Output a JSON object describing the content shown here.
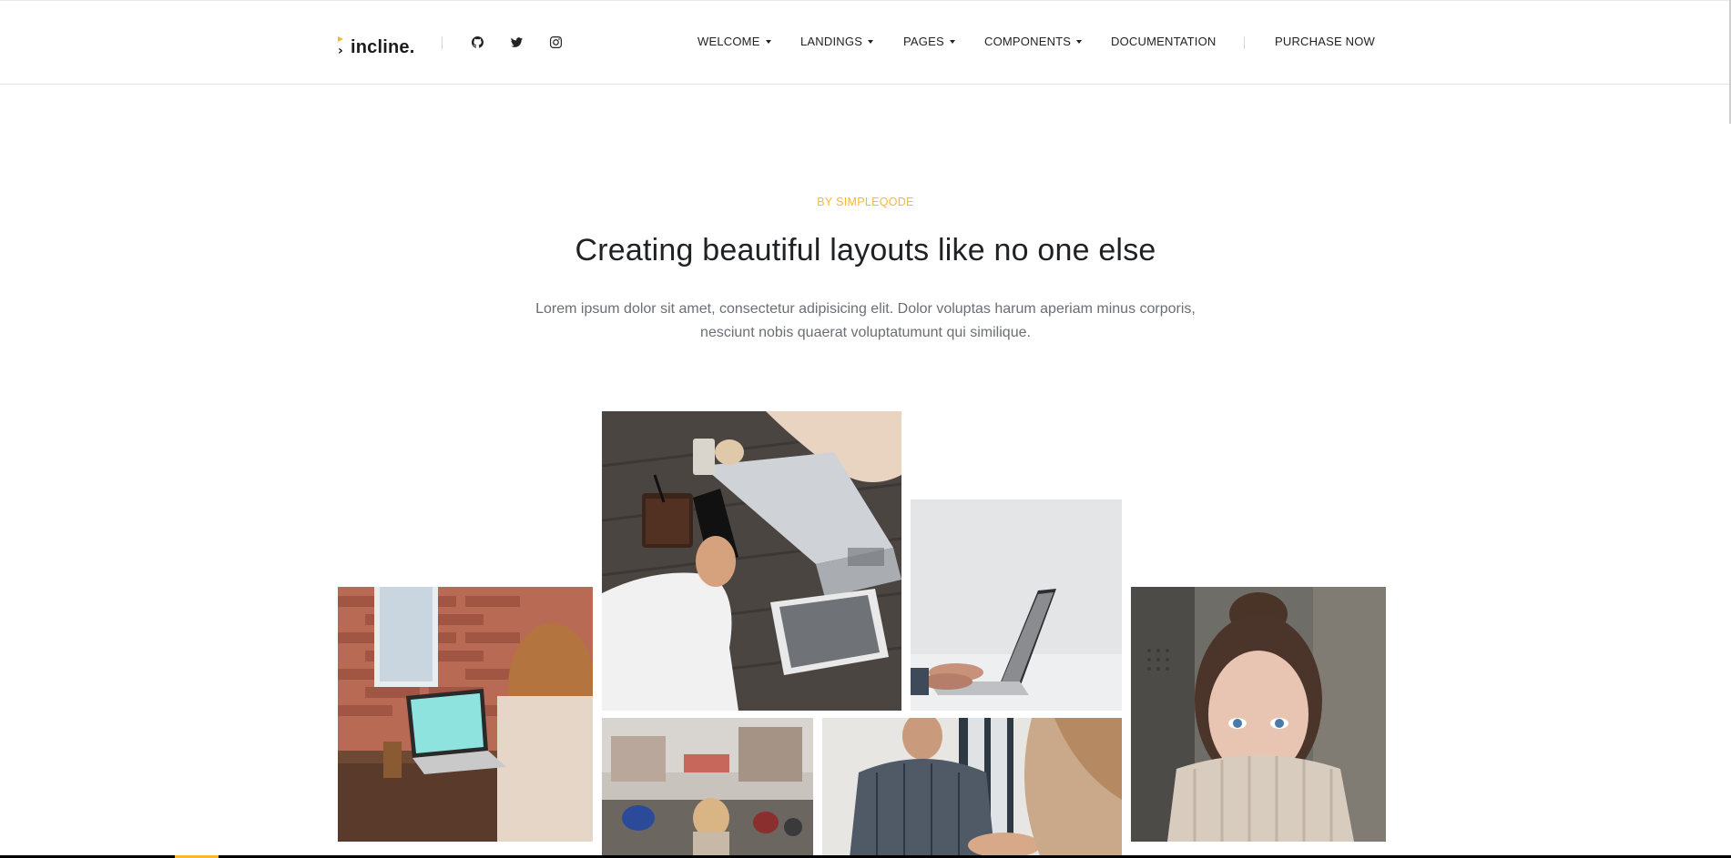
{
  "brand": {
    "name": "incline.",
    "logo_icon": "incline-chevron-logo",
    "accent_color": "#f7b731"
  },
  "social": [
    {
      "name": "github",
      "icon": "github-icon"
    },
    {
      "name": "twitter",
      "icon": "twitter-icon"
    },
    {
      "name": "instagram",
      "icon": "instagram-icon"
    }
  ],
  "nav": {
    "welcome": "WELCOME",
    "landings": "LANDINGS",
    "pages": "PAGES",
    "components": "COMPONENTS",
    "documentation": "DOCUMENTATION",
    "purchase": "PURCHASE NOW"
  },
  "hero": {
    "eyebrow": "BY SIMPLEQODE",
    "title": "Creating beautiful layouts like no one else",
    "lead": "Lorem ipsum dolor sit amet, consectetur adipisicing elit. Dolor voluptas harum aperiam minus corporis, nesciunt nobis quaerat voluptatumunt qui similique."
  },
  "gallery": [
    {
      "subject": "woman-with-laptop-brick-wall"
    },
    {
      "subject": "coffee-phone-laptop-table"
    },
    {
      "subject": "hands-on-laptop-white"
    },
    {
      "subject": "woman-sweater-portrait"
    },
    {
      "subject": "street-crowd"
    },
    {
      "subject": "handshake-office"
    }
  ],
  "colors": {
    "accent": "#f7b731",
    "heading": "#1f2125",
    "body": "#6a6f75"
  }
}
